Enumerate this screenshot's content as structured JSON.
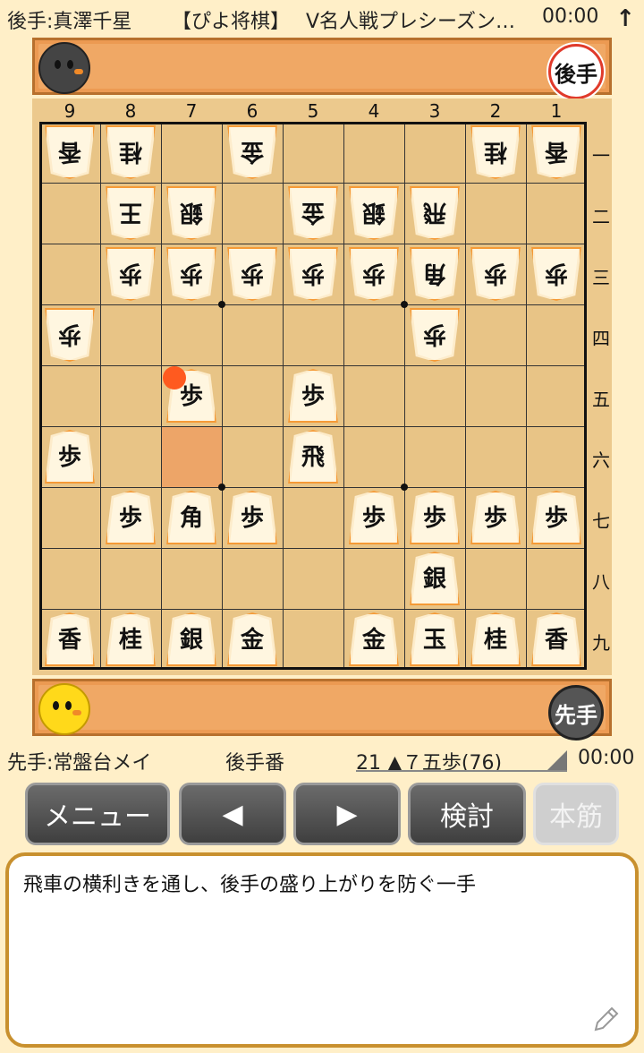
{
  "header": {
    "gote_player": "後手:真澤千星",
    "app_name": "【ぴよ将棋】",
    "event": "V名人戦プレシーズン…",
    "gote_time": "00:00",
    "arrow_icon": "arrow-up-icon"
  },
  "gote_stand": {
    "badge": "後手",
    "avatar_icon": "black-chick-icon"
  },
  "sente_stand": {
    "badge": "先手",
    "avatar_icon": "yellow-chick-icon"
  },
  "board": {
    "files": [
      "9",
      "8",
      "7",
      "6",
      "5",
      "4",
      "3",
      "2",
      "1"
    ],
    "ranks": [
      "一",
      "二",
      "三",
      "四",
      "五",
      "六",
      "七",
      "八",
      "九"
    ],
    "pieces": [
      {
        "label": "香",
        "owner": "gote",
        "file": 9,
        "rank": 1
      },
      {
        "label": "桂",
        "owner": "gote",
        "file": 8,
        "rank": 1
      },
      {
        "label": "金",
        "owner": "gote",
        "file": 6,
        "rank": 1
      },
      {
        "label": "桂",
        "owner": "gote",
        "file": 2,
        "rank": 1
      },
      {
        "label": "香",
        "owner": "gote",
        "file": 1,
        "rank": 1
      },
      {
        "label": "王",
        "owner": "gote",
        "file": 8,
        "rank": 2
      },
      {
        "label": "銀",
        "owner": "gote",
        "file": 7,
        "rank": 2
      },
      {
        "label": "金",
        "owner": "gote",
        "file": 5,
        "rank": 2
      },
      {
        "label": "銀",
        "owner": "gote",
        "file": 4,
        "rank": 2
      },
      {
        "label": "飛",
        "owner": "gote",
        "file": 3,
        "rank": 2
      },
      {
        "label": "歩",
        "owner": "gote",
        "file": 8,
        "rank": 3
      },
      {
        "label": "歩",
        "owner": "gote",
        "file": 7,
        "rank": 3
      },
      {
        "label": "歩",
        "owner": "gote",
        "file": 6,
        "rank": 3
      },
      {
        "label": "歩",
        "owner": "gote",
        "file": 5,
        "rank": 3
      },
      {
        "label": "歩",
        "owner": "gote",
        "file": 4,
        "rank": 3
      },
      {
        "label": "角",
        "owner": "gote",
        "file": 3,
        "rank": 3
      },
      {
        "label": "歩",
        "owner": "gote",
        "file": 2,
        "rank": 3
      },
      {
        "label": "歩",
        "owner": "gote",
        "file": 1,
        "rank": 3
      },
      {
        "label": "歩",
        "owner": "gote",
        "file": 9,
        "rank": 4
      },
      {
        "label": "歩",
        "owner": "gote",
        "file": 3,
        "rank": 4
      },
      {
        "label": "歩",
        "owner": "sente",
        "file": 7,
        "rank": 5
      },
      {
        "label": "歩",
        "owner": "sente",
        "file": 5,
        "rank": 5
      },
      {
        "label": "歩",
        "owner": "sente",
        "file": 9,
        "rank": 6
      },
      {
        "label": "飛",
        "owner": "sente",
        "file": 5,
        "rank": 6
      },
      {
        "label": "歩",
        "owner": "sente",
        "file": 8,
        "rank": 7
      },
      {
        "label": "角",
        "owner": "sente",
        "file": 7,
        "rank": 7
      },
      {
        "label": "歩",
        "owner": "sente",
        "file": 6,
        "rank": 7
      },
      {
        "label": "歩",
        "owner": "sente",
        "file": 4,
        "rank": 7
      },
      {
        "label": "歩",
        "owner": "sente",
        "file": 3,
        "rank": 7
      },
      {
        "label": "歩",
        "owner": "sente",
        "file": 2,
        "rank": 7
      },
      {
        "label": "歩",
        "owner": "sente",
        "file": 1,
        "rank": 7
      },
      {
        "label": "銀",
        "owner": "sente",
        "file": 3,
        "rank": 8
      },
      {
        "label": "香",
        "owner": "sente",
        "file": 9,
        "rank": 9
      },
      {
        "label": "桂",
        "owner": "sente",
        "file": 8,
        "rank": 9
      },
      {
        "label": "銀",
        "owner": "sente",
        "file": 7,
        "rank": 9
      },
      {
        "label": "金",
        "owner": "sente",
        "file": 6,
        "rank": 9
      },
      {
        "label": "金",
        "owner": "sente",
        "file": 4,
        "rank": 9
      },
      {
        "label": "玉",
        "owner": "sente",
        "file": 3,
        "rank": 9
      },
      {
        "label": "桂",
        "owner": "sente",
        "file": 2,
        "rank": 9
      },
      {
        "label": "香",
        "owner": "sente",
        "file": 1,
        "rank": 9
      }
    ],
    "last_move_from": {
      "file": 7,
      "rank": 6
    },
    "last_move_to": {
      "file": 7,
      "rank": 5
    }
  },
  "status": {
    "sente_player": "先手:常盤台メイ",
    "turn": "後手番",
    "move": "21 ▲７五歩(76)",
    "sente_time": "00:00"
  },
  "buttons": {
    "menu": "メニュー",
    "prev": "◀",
    "next": "▶",
    "analyze": "検討",
    "mainline": "本筋"
  },
  "comment": {
    "text": "飛車の横利きを通し、後手の盛り上がりを防ぐ一手",
    "edit_icon": "pencil-icon"
  },
  "colors": {
    "background": "#ffefc8",
    "stand": "#f0a865",
    "board": "#e8c486",
    "piece_border": "#f59a36",
    "last_move": "#ff5a1f",
    "button": "#4f4f4f",
    "comment_border": "#c8902e"
  }
}
